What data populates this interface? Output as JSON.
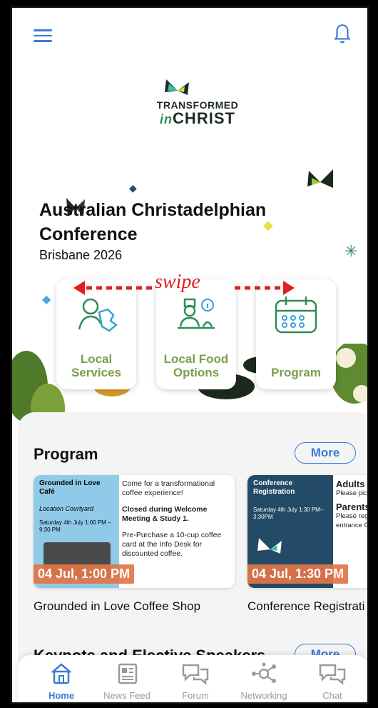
{
  "header": {
    "menu_icon": "hamburger-icon",
    "notification_icon": "bell-icon"
  },
  "logo": {
    "line1": "TRANSFORMED",
    "line2_prefix": "in",
    "line2": "CHRIST"
  },
  "hero": {
    "title": "Australian Christadelphian Conference",
    "subtitle": "Brisbane 2026"
  },
  "swipe_hint": "swipe",
  "tiles": [
    {
      "label": "Local Services",
      "icon": "local-services-icon"
    },
    {
      "label": "Local Food Options",
      "icon": "food-info-icon"
    },
    {
      "label": "Program",
      "icon": "calendar-icon"
    }
  ],
  "program": {
    "title": "Program",
    "more": "More",
    "events": [
      {
        "card_title": "Grounded in Love Café",
        "location": "Location Courtyard",
        "when": "Saturday 4th July 1:00 PM – 9:30 PM",
        "desc1": "Come for a transformational coffee experience!",
        "desc2": "Closed during Welcome Meeting & Study 1.",
        "desc3": "Pre-Purchase a 10-cup coffee card at the Info Desk for discounted coffee.",
        "date": "04 Jul, 1:00 PM",
        "title": "Grounded in Love Coffee Shop"
      },
      {
        "card_title": "Conference Registration",
        "when": "Saturday 4th July 1:30 PM– 3:30PM",
        "desc1": "Adults",
        "desc2": "Please pick up your pack in the",
        "desc3": "Parents",
        "desc4": "Please register old children entrance OR",
        "date": "04 Jul, 1:30 PM",
        "title": "Conference Registrati"
      }
    ]
  },
  "speakers": {
    "title": "Keynote and Elective Speakers",
    "more": "More"
  },
  "nav": [
    {
      "label": "Home",
      "icon": "home-icon",
      "active": true
    },
    {
      "label": "News Feed",
      "icon": "newsfeed-icon"
    },
    {
      "label": "Forum",
      "icon": "forum-icon"
    },
    {
      "label": "Networking",
      "icon": "networking-icon"
    },
    {
      "label": "Chat",
      "icon": "chat-icon"
    }
  ],
  "colors": {
    "accent": "#3a7bd5",
    "tile_label": "#7a9e4a",
    "date_pill": "#e37445",
    "swipe": "#e02020"
  }
}
